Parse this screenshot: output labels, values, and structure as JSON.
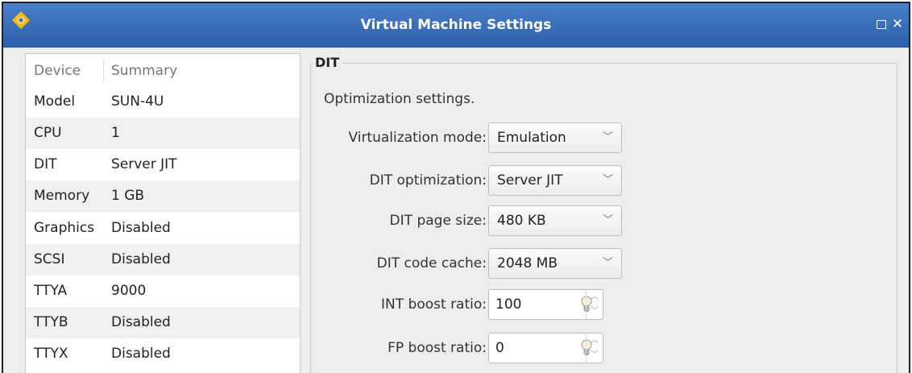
{
  "window": {
    "title": "Virtual Machine Settings"
  },
  "devices": {
    "headers": {
      "device": "Device",
      "summary": "Summary"
    },
    "rows": [
      {
        "device": "Model",
        "summary": "SUN-4U"
      },
      {
        "device": "CPU",
        "summary": "1"
      },
      {
        "device": "DIT",
        "summary": "Server JIT"
      },
      {
        "device": "Memory",
        "summary": "1 GB"
      },
      {
        "device": "Graphics",
        "summary": "Disabled"
      },
      {
        "device": "SCSI",
        "summary": "Disabled"
      },
      {
        "device": "TTYA",
        "summary": "9000"
      },
      {
        "device": "TTYB",
        "summary": "Disabled"
      },
      {
        "device": "TTYX",
        "summary": "Disabled"
      }
    ]
  },
  "dit": {
    "group_title": "DIT",
    "description": "Optimization settings.",
    "virtualization_mode": {
      "label": "Virtualization mode:",
      "value": "Emulation"
    },
    "dit_optimization": {
      "label": "DIT optimization:",
      "value": "Server JIT"
    },
    "dit_page_size": {
      "label": "DIT page size:",
      "value": "480 KB"
    },
    "dit_code_cache": {
      "label": "DIT code cache:",
      "value": "2048 MB"
    },
    "int_boost_ratio": {
      "label": "INT boost ratio:",
      "value": "100"
    },
    "fp_boost_ratio": {
      "label": "FP boost ratio:",
      "value": "0"
    }
  },
  "icons": {
    "app": "app-logo-icon",
    "maximize": "maximize-icon",
    "close": "close-icon",
    "dropdown": "chevron-down-icon",
    "hint": "lightbulb-icon",
    "spin_up": "spin-up-icon",
    "spin_down": "spin-down-icon"
  },
  "colors": {
    "titlebar": "#3a6fbd",
    "accent": "#f5b90f"
  }
}
